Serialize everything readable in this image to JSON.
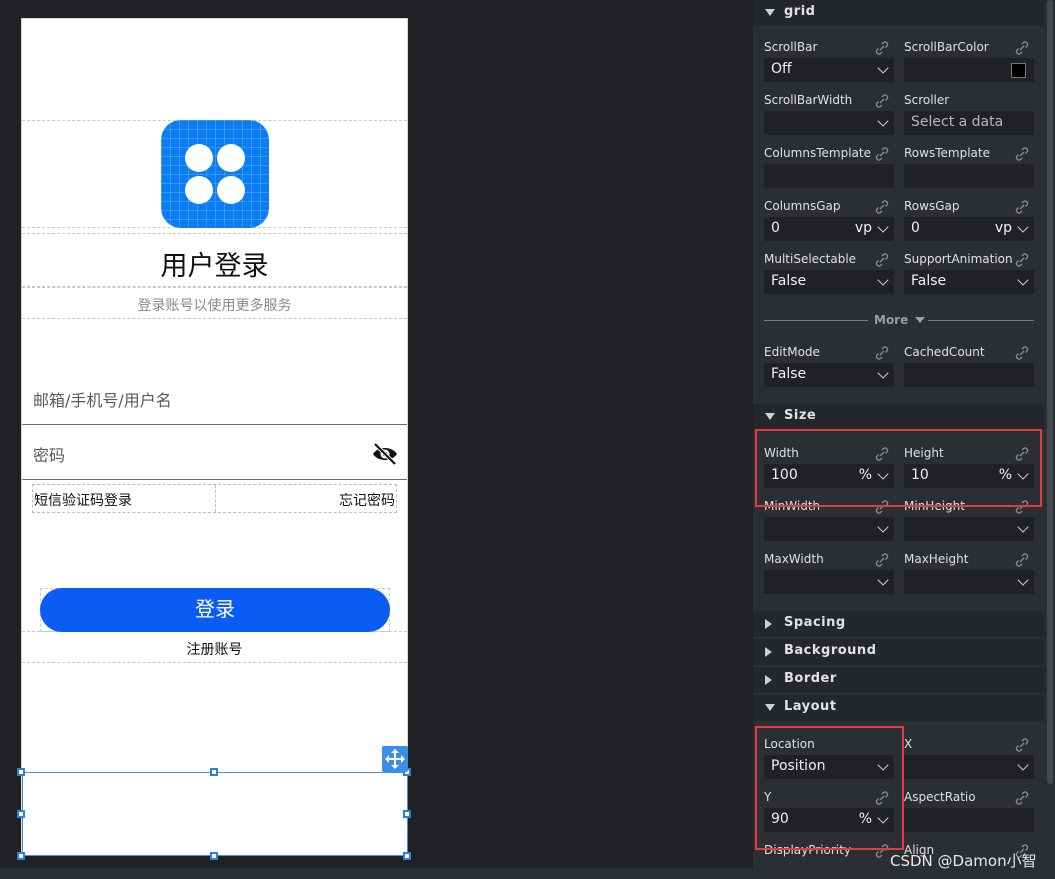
{
  "canvas": {
    "title": "用户登录",
    "subtitle": "登录账号以使用更多服务",
    "username_placeholder": "邮箱/手机号/用户名",
    "password_placeholder": "密码",
    "sms_login": "短信验证码登录",
    "forgot_password": "忘记密码",
    "login_button": "登录",
    "register": "注册账号"
  },
  "panel": {
    "grid_section": "grid",
    "size_section": "Size",
    "spacing_section": "Spacing",
    "background_section": "Background",
    "border_section": "Border",
    "layout_section": "Layout",
    "more_label": "More",
    "props": {
      "scrollbar": {
        "label": "ScrollBar",
        "value": "Off"
      },
      "scrollbarcolor": {
        "label": "ScrollBarColor",
        "color": "#000000"
      },
      "scrollbarwidth": {
        "label": "ScrollBarWidth",
        "value": ""
      },
      "scroller": {
        "label": "Scroller",
        "placeholder": "Select a data"
      },
      "columnstemplate": {
        "label": "ColumnsTemplate",
        "value": ""
      },
      "rowstemplate": {
        "label": "RowsTemplate",
        "value": ""
      },
      "columnsgap": {
        "label": "ColumnsGap",
        "value": "0",
        "unit": "vp"
      },
      "rowsgap": {
        "label": "RowsGap",
        "value": "0",
        "unit": "vp"
      },
      "multiselectable": {
        "label": "MultiSelectable",
        "value": "False"
      },
      "supportanimation": {
        "label": "SupportAnimation",
        "value": "False"
      },
      "editmode": {
        "label": "EditMode",
        "value": "False"
      },
      "cachedcount": {
        "label": "CachedCount",
        "value": ""
      },
      "width": {
        "label": "Width",
        "value": "100",
        "unit": "%"
      },
      "height": {
        "label": "Height",
        "value": "10",
        "unit": "%"
      },
      "minwidth": {
        "label": "MinWidth",
        "value": ""
      },
      "minheight": {
        "label": "MinHeight",
        "value": ""
      },
      "maxwidth": {
        "label": "MaxWidth",
        "value": ""
      },
      "maxheight": {
        "label": "MaxHeight",
        "value": ""
      },
      "location": {
        "label": "Location",
        "value": "Position"
      },
      "x": {
        "label": "X",
        "value": ""
      },
      "y": {
        "label": "Y",
        "value": "90",
        "unit": "%"
      },
      "aspectratio": {
        "label": "AspectRatio",
        "value": ""
      },
      "displaypriority": {
        "label": "DisplayPriority"
      },
      "align": {
        "label": "Align"
      }
    }
  },
  "watermark": "CSDN @Damon小智",
  "colors": {
    "primary_button": "#0a5cf5",
    "app_icon": "#0a7df2",
    "highlight": "#e23d3d",
    "selection": "#4a90e2"
  }
}
